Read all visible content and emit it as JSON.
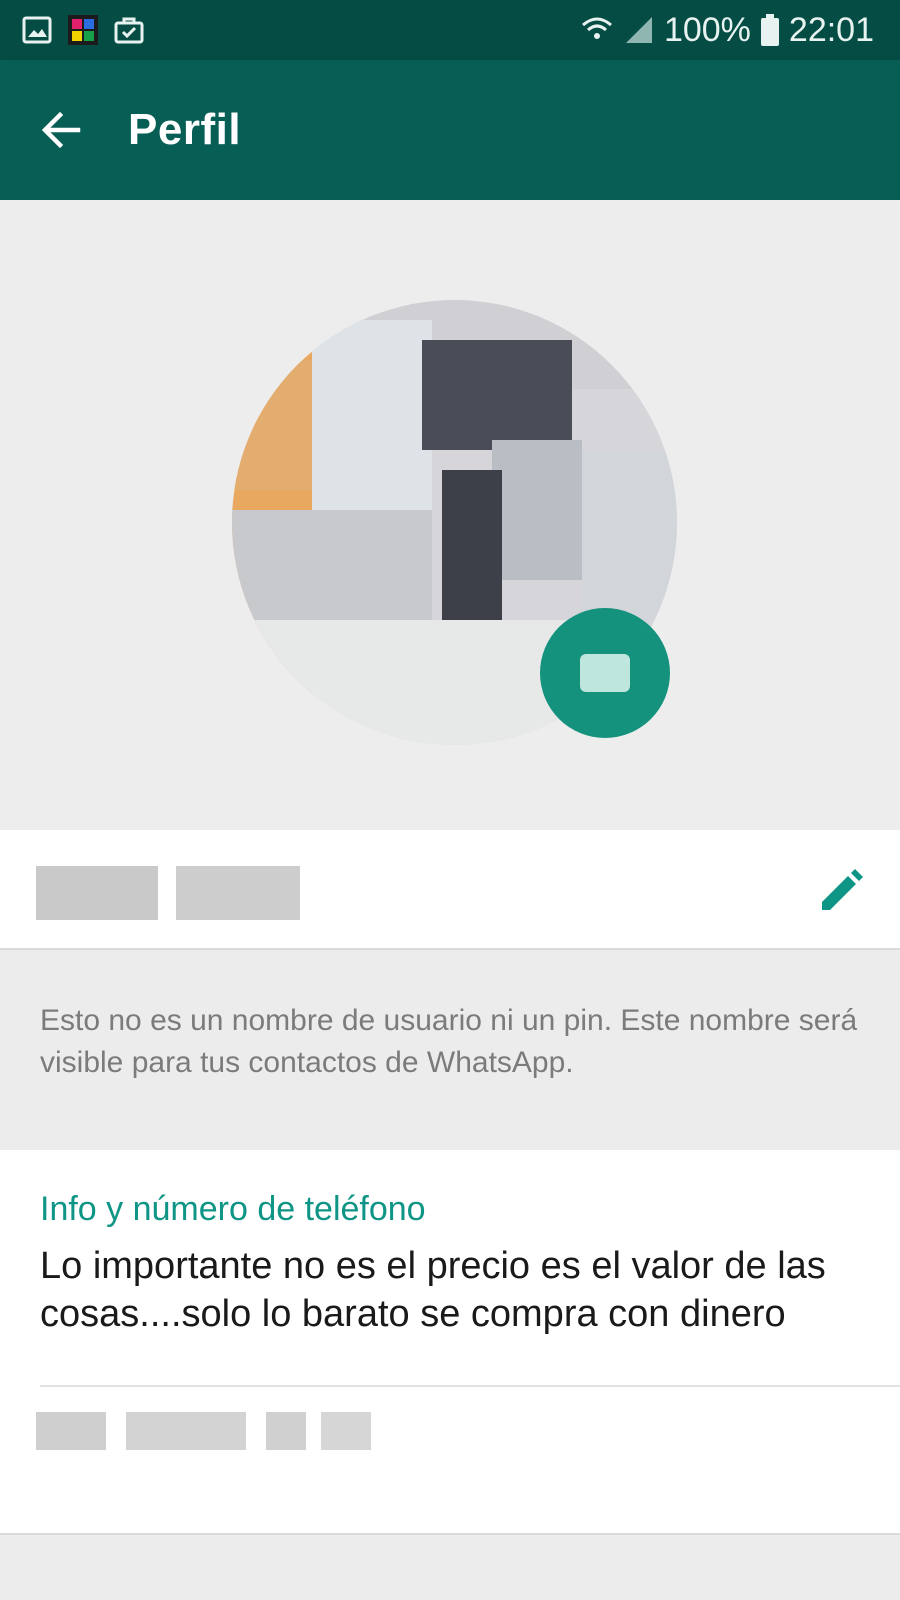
{
  "status_bar": {
    "left_icons": [
      "image-icon",
      "color-app-icon",
      "briefcase-check-icon"
    ],
    "battery": "100%",
    "time": "22:01",
    "icons": [
      "wifi-icon",
      "signal-icon",
      "battery-icon"
    ]
  },
  "app_bar": {
    "title": "Perfil",
    "back_icon": "arrow-left-icon"
  },
  "profile": {
    "photo_icon": "camera-icon",
    "edit_icon": "pencil-icon",
    "name_hint": "Esto no es un nombre de usuario ni un pin. Este nombre será visible para tus contactos de WhatsApp."
  },
  "info": {
    "label": "Info y número de teléfono",
    "about": "Lo importante no es el precio es el valor de las cosas....solo lo barato se compra con dinero"
  },
  "colors": {
    "status_bar": "#054d44",
    "app_bar": "#075e54",
    "accent": "#0f9585",
    "camera_button": "#14927e"
  }
}
